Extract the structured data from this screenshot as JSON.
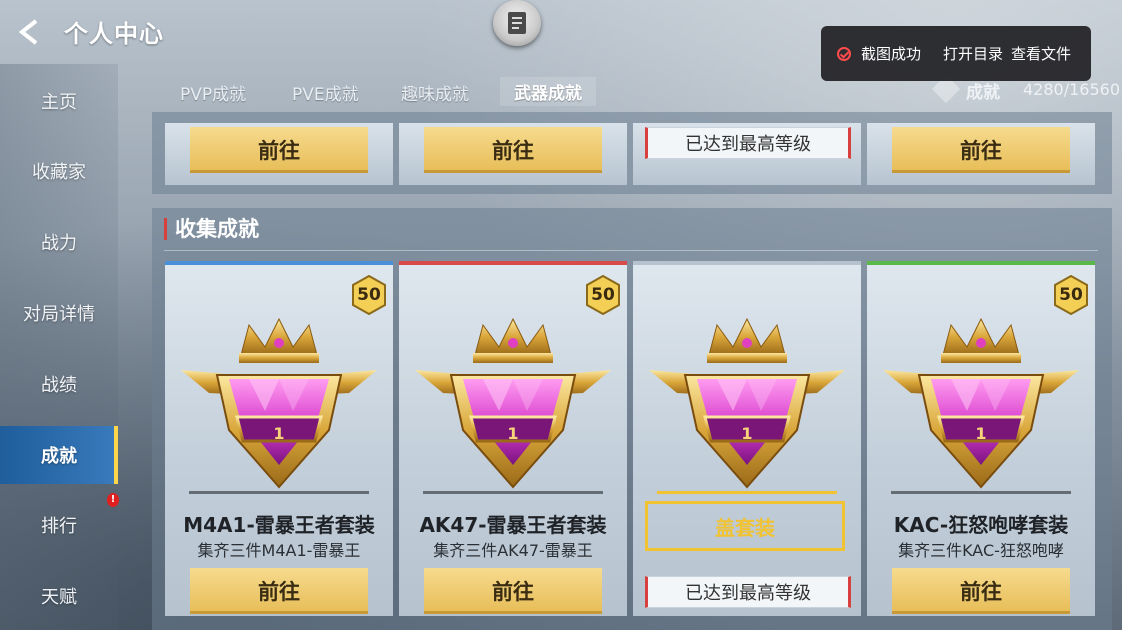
{
  "header": {
    "title": "个人中心"
  },
  "toast": {
    "message": "截图成功",
    "open_dir": "打开目录",
    "view_file": "查看文件"
  },
  "sidebar": {
    "items": [
      {
        "label": "主页"
      },
      {
        "label": "收藏家"
      },
      {
        "label": "战力"
      },
      {
        "label": "对局详情"
      },
      {
        "label": "战绩"
      },
      {
        "label": "成就"
      },
      {
        "label": "排行"
      },
      {
        "label": "天赋"
      }
    ],
    "active_index": 5,
    "alert_badge": "!"
  },
  "tabs": [
    {
      "label": "PVP成就"
    },
    {
      "label": "PVE成就"
    },
    {
      "label": "趣味成就"
    },
    {
      "label": "武器成就"
    }
  ],
  "achievement": {
    "label": "成就",
    "count": "4280/16560"
  },
  "top_row": [
    {
      "type": "button",
      "label": "前往"
    },
    {
      "type": "button",
      "label": "前往"
    },
    {
      "type": "max",
      "label": "已达到最高等级"
    },
    {
      "type": "button",
      "label": "前往"
    }
  ],
  "section": {
    "title": "收集成就"
  },
  "cards": [
    {
      "points": "50",
      "level": "1",
      "name": "M4A1-雷暴王者套装",
      "desc": "集齐三件M4A1-雷暴王",
      "action": "前往",
      "accent": "#4a90d9"
    },
    {
      "points": "50",
      "level": "1",
      "name": "AK47-雷暴王者套装",
      "desc": "集齐三件AK47-雷暴王",
      "action": "前往",
      "accent": "#d94a4a"
    },
    {
      "points": "",
      "level": "1",
      "name": "",
      "desc": "",
      "set_label": "盖套装",
      "action": "已达到最高等级",
      "accent": ""
    },
    {
      "points": "50",
      "level": "1",
      "name": "KAC-狂怒咆哮套装",
      "desc": "集齐三件KAC-狂怒咆哮",
      "action": "前往",
      "accent": "#5ab84a"
    }
  ]
}
